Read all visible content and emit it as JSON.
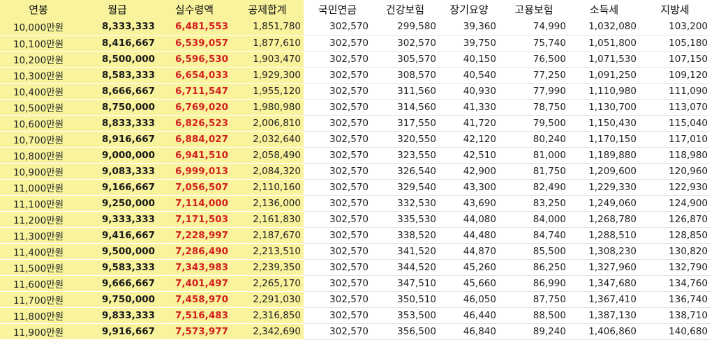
{
  "colors": {
    "highlight_bg": "#f8f39c",
    "net_pay_text": "#d42020"
  },
  "table": {
    "headers": [
      "연봉",
      "월급",
      "실수령액",
      "공제합계",
      "국민연금",
      "건강보험",
      "장기요양",
      "고용보험",
      "소득세",
      "지방세"
    ],
    "rows": [
      [
        "10,000만원",
        "8,333,333",
        "6,481,553",
        "1,851,780",
        "302,570",
        "299,580",
        "39,360",
        "74,990",
        "1,032,080",
        "103,200"
      ],
      [
        "10,100만원",
        "8,416,667",
        "6,539,057",
        "1,877,610",
        "302,570",
        "302,570",
        "39,750",
        "75,740",
        "1,051,800",
        "105,180"
      ],
      [
        "10,200만원",
        "8,500,000",
        "6,596,530",
        "1,903,470",
        "302,570",
        "305,570",
        "40,150",
        "76,500",
        "1,071,530",
        "107,150"
      ],
      [
        "10,300만원",
        "8,583,333",
        "6,654,033",
        "1,929,300",
        "302,570",
        "308,570",
        "40,540",
        "77,250",
        "1,091,250",
        "109,120"
      ],
      [
        "10,400만원",
        "8,666,667",
        "6,711,547",
        "1,955,120",
        "302,570",
        "311,560",
        "40,930",
        "77,990",
        "1,110,980",
        "111,090"
      ],
      [
        "10,500만원",
        "8,750,000",
        "6,769,020",
        "1,980,980",
        "302,570",
        "314,560",
        "41,330",
        "78,750",
        "1,130,700",
        "113,070"
      ],
      [
        "10,600만원",
        "8,833,333",
        "6,826,523",
        "2,006,810",
        "302,570",
        "317,550",
        "41,720",
        "79,500",
        "1,150,430",
        "115,040"
      ],
      [
        "10,700만원",
        "8,916,667",
        "6,884,027",
        "2,032,640",
        "302,570",
        "320,550",
        "42,120",
        "80,240",
        "1,170,150",
        "117,010"
      ],
      [
        "10,800만원",
        "9,000,000",
        "6,941,510",
        "2,058,490",
        "302,570",
        "323,550",
        "42,510",
        "81,000",
        "1,189,880",
        "118,980"
      ],
      [
        "10,900만원",
        "9,083,333",
        "6,999,013",
        "2,084,320",
        "302,570",
        "326,540",
        "42,900",
        "81,750",
        "1,209,600",
        "120,960"
      ],
      [
        "11,000만원",
        "9,166,667",
        "7,056,507",
        "2,110,160",
        "302,570",
        "329,540",
        "43,300",
        "82,490",
        "1,229,330",
        "122,930"
      ],
      [
        "11,100만원",
        "9,250,000",
        "7,114,000",
        "2,136,000",
        "302,570",
        "332,530",
        "43,690",
        "83,250",
        "1,249,060",
        "124,900"
      ],
      [
        "11,200만원",
        "9,333,333",
        "7,171,503",
        "2,161,830",
        "302,570",
        "335,530",
        "44,080",
        "84,000",
        "1,268,780",
        "126,870"
      ],
      [
        "11,300만원",
        "9,416,667",
        "7,228,997",
        "2,187,670",
        "302,570",
        "338,520",
        "44,480",
        "84,740",
        "1,288,510",
        "128,850"
      ],
      [
        "11,400만원",
        "9,500,000",
        "7,286,490",
        "2,213,510",
        "302,570",
        "341,520",
        "44,870",
        "85,500",
        "1,308,230",
        "130,820"
      ],
      [
        "11,500만원",
        "9,583,333",
        "7,343,983",
        "2,239,350",
        "302,570",
        "344,520",
        "45,260",
        "86,250",
        "1,327,960",
        "132,790"
      ],
      [
        "11,600만원",
        "9,666,667",
        "7,401,497",
        "2,265,170",
        "302,570",
        "347,510",
        "45,660",
        "86,990",
        "1,347,680",
        "134,760"
      ],
      [
        "11,700만원",
        "9,750,000",
        "7,458,970",
        "2,291,030",
        "302,570",
        "350,510",
        "46,050",
        "87,750",
        "1,367,410",
        "136,740"
      ],
      [
        "11,800만원",
        "9,833,333",
        "7,516,483",
        "2,316,850",
        "302,570",
        "353,500",
        "46,440",
        "88,500",
        "1,387,130",
        "138,710"
      ],
      [
        "11,900만원",
        "9,916,667",
        "7,573,977",
        "2,342,690",
        "302,570",
        "356,500",
        "46,840",
        "89,240",
        "1,406,860",
        "140,680"
      ]
    ]
  }
}
